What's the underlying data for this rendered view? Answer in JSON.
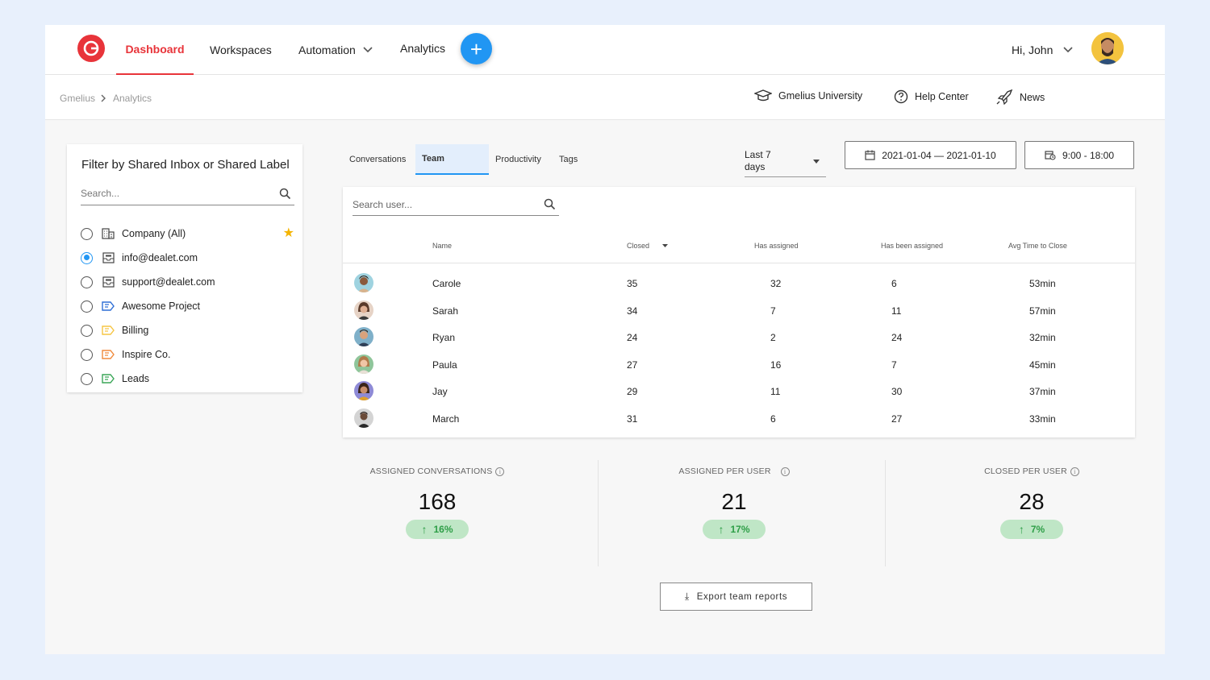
{
  "nav": {
    "items": [
      {
        "label": "Dashboard",
        "active": true
      },
      {
        "label": "Workspaces"
      },
      {
        "label": "Automation"
      },
      {
        "label": "Analytics"
      }
    ],
    "plus_label": "+",
    "greeting": "Hi, John",
    "accent_color": "#e8343a",
    "primary_color": "#2196f3"
  },
  "breadcrumb": [
    "Gmelius",
    "Analytics"
  ],
  "help_links": [
    {
      "label": "Gmelius University",
      "icon": "graduation-cap-icon"
    },
    {
      "label": "Help Center",
      "icon": "question-circle-icon"
    },
    {
      "label": "News",
      "icon": "rocket-icon"
    }
  ],
  "filter": {
    "title": "Filter by Shared Inbox or Shared Label",
    "search_placeholder": "Search...",
    "items": [
      {
        "label": "Company (All)",
        "icon": "building-icon",
        "checked": false,
        "starred": true
      },
      {
        "label": "info@dealet.com",
        "icon": "inbox-icon",
        "checked": true
      },
      {
        "label": "support@dealet.com",
        "icon": "inbox-icon",
        "checked": false
      },
      {
        "label": "Awesome Project",
        "icon": "label-icon",
        "color": "#2f6fd6",
        "checked": false
      },
      {
        "label": "Billing",
        "icon": "label-icon",
        "color": "#f6c544",
        "checked": false
      },
      {
        "label": "Inspire Co.",
        "icon": "label-icon",
        "color": "#f08a3c",
        "checked": false
      },
      {
        "label": "Leads",
        "icon": "label-icon",
        "color": "#3aa657",
        "checked": false
      }
    ]
  },
  "tabs": [
    {
      "label": "Conversations"
    },
    {
      "label": "Team",
      "active": true
    },
    {
      "label": "Productivity"
    },
    {
      "label": "Tags"
    }
  ],
  "range": {
    "label_line1": "Last 7",
    "label_line2": "days"
  },
  "date_range": "2021-01-04 — 2021-01-10",
  "time_range": "9:00 - 18:00",
  "team_table": {
    "search_placeholder": "Search user...",
    "columns": [
      "Name",
      "Closed",
      "Has assigned",
      "Has been assigned",
      "Avg Time to Close"
    ],
    "rows": [
      {
        "name": "Carole",
        "closed": "35",
        "has_assigned": "32",
        "been_assigned": "6",
        "avg": "53min"
      },
      {
        "name": "Sarah",
        "closed": "34",
        "has_assigned": "7",
        "been_assigned": "11",
        "avg": "57min"
      },
      {
        "name": "Ryan",
        "closed": "24",
        "has_assigned": "2",
        "been_assigned": "24",
        "avg": "32min"
      },
      {
        "name": "Paula",
        "closed": "27",
        "has_assigned": "16",
        "been_assigned": "7",
        "avg": "45min"
      },
      {
        "name": "Jay",
        "closed": "29",
        "has_assigned": "11",
        "been_assigned": "30",
        "avg": "37min"
      },
      {
        "name": "March",
        "closed": "31",
        "has_assigned": "6",
        "been_assigned": "27",
        "avg": "33min"
      }
    ]
  },
  "stats": [
    {
      "label": "ASSIGNED CONVERSATIONS",
      "value": "168",
      "change": "16%"
    },
    {
      "label": "ASSIGNED PER USER",
      "value": "21",
      "change": "17%"
    },
    {
      "label": "CLOSED PER USER",
      "value": "28",
      "change": "7%"
    }
  ],
  "export_label": "Export team reports"
}
